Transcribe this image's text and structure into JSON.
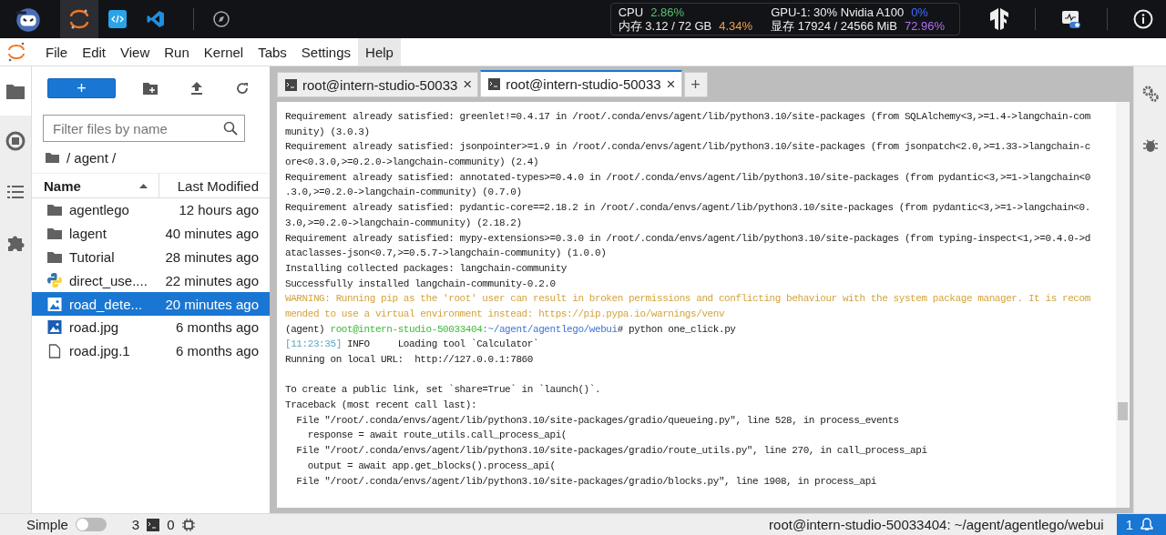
{
  "top_bar": {
    "cpu_label": "CPU",
    "cpu_value": "2.86%",
    "mem_label": "内存 3.12 / 72 GB",
    "mem_value": "4.34%",
    "gpu_label": "GPU-1: 30% Nvidia A100",
    "gpu_value": "0%",
    "vram_label": "显存 17924 / 24566 MiB",
    "vram_value": "72.96%"
  },
  "menu": [
    {
      "label": "File",
      "selected": false
    },
    {
      "label": "Edit",
      "selected": false
    },
    {
      "label": "View",
      "selected": false
    },
    {
      "label": "Run",
      "selected": false
    },
    {
      "label": "Kernel",
      "selected": false
    },
    {
      "label": "Tabs",
      "selected": false
    },
    {
      "label": "Settings",
      "selected": false
    },
    {
      "label": "Help",
      "selected": true
    }
  ],
  "file_browser": {
    "new_button": "+",
    "filter_placeholder": "Filter files by name",
    "path": "/ agent /",
    "columns": [
      "Name",
      "Last Modified"
    ],
    "files": [
      {
        "name": "agentlego",
        "modified": "12 hours ago",
        "kind": "folder",
        "selected": false
      },
      {
        "name": "lagent",
        "modified": "40 minutes ago",
        "kind": "folder",
        "selected": false
      },
      {
        "name": "Tutorial",
        "modified": "28 minutes ago",
        "kind": "folder",
        "selected": false
      },
      {
        "name": "direct_use....",
        "modified": "22 minutes ago",
        "kind": "python",
        "selected": false
      },
      {
        "name": "road_dete...",
        "modified": "20 minutes ago",
        "kind": "image",
        "selected": true
      },
      {
        "name": "road.jpg",
        "modified": "6 months ago",
        "kind": "image",
        "selected": false
      },
      {
        "name": "road.jpg.1",
        "modified": "6 months ago",
        "kind": "file",
        "selected": false
      }
    ]
  },
  "tabs": [
    {
      "label": "root@intern-studio-50033",
      "close": "×",
      "selected": false
    },
    {
      "label": "root@intern-studio-50033",
      "close": "×",
      "selected": true
    }
  ],
  "new_tab": "+",
  "terminal": [
    {
      "kind": "plain",
      "text": "Requirement already satisfied: greenlet!=0.4.17 in /root/.conda/envs/agent/lib/python3.10/site-packages (from SQLAlchemy<3,>=1.4->langchain-com"
    },
    {
      "kind": "plain",
      "text": "munity) (3.0.3)"
    },
    {
      "kind": "plain",
      "text": "Requirement already satisfied: jsonpointer>=1.9 in /root/.conda/envs/agent/lib/python3.10/site-packages (from jsonpatch<2.0,>=1.33->langchain-c"
    },
    {
      "kind": "plain",
      "text": "ore<0.3.0,>=0.2.0->langchain-community) (2.4)"
    },
    {
      "kind": "plain",
      "text": "Requirement already satisfied: annotated-types>=0.4.0 in /root/.conda/envs/agent/lib/python3.10/site-packages (from pydantic<3,>=1->langchain<0"
    },
    {
      "kind": "plain",
      "text": ".3.0,>=0.2.0->langchain-community) (0.7.0)"
    },
    {
      "kind": "plain",
      "text": "Requirement already satisfied: pydantic-core==2.18.2 in /root/.conda/envs/agent/lib/python3.10/site-packages (from pydantic<3,>=1->langchain<0."
    },
    {
      "kind": "plain",
      "text": "3.0,>=0.2.0->langchain-community) (2.18.2)"
    },
    {
      "kind": "plain",
      "text": "Requirement already satisfied: mypy-extensions>=0.3.0 in /root/.conda/envs/agent/lib/python3.10/site-packages (from typing-inspect<1,>=0.4.0->d"
    },
    {
      "kind": "plain",
      "text": "ataclasses-json<0.7,>=0.5.7->langchain-community) (1.0.0)"
    },
    {
      "kind": "plain",
      "text": "Installing collected packages: langchain-community"
    },
    {
      "kind": "plain",
      "text": "Successfully installed langchain-community-0.2.0"
    },
    {
      "kind": "warning",
      "text": "WARNING: Running pip as the 'root' user can result in broken permissions and conflicting behaviour with the system package manager. It is recom"
    },
    {
      "kind": "warning",
      "text": "mended to use a virtual environment instead: https://pip.pypa.io/warnings/venv"
    },
    {
      "kind": "prompt",
      "env": "(agent)",
      "user": "root@intern-studio-50033404",
      "path": ":~/agent/agentlego/webui",
      "text": "# python one_click.py"
    },
    {
      "kind": "info",
      "time": "[11:23:35]",
      "text": "INFO     Loading tool `Calculator`"
    },
    {
      "kind": "plain",
      "text": "Running on local URL:  http://127.0.0.1:7860"
    },
    {
      "kind": "blank"
    },
    {
      "kind": "plain",
      "text": "To create a public link, set `share=True` in `launch()`."
    },
    {
      "kind": "plain",
      "text": "Traceback (most recent call last):"
    },
    {
      "kind": "plain",
      "text": "  File \"/root/.conda/envs/agent/lib/python3.10/site-packages/gradio/queueing.py\", line 528, in process_events"
    },
    {
      "kind": "plain",
      "text": "    response = await route_utils.call_process_api("
    },
    {
      "kind": "plain",
      "text": "  File \"/root/.conda/envs/agent/lib/python3.10/site-packages/gradio/route_utils.py\", line 270, in call_process_api"
    },
    {
      "kind": "plain",
      "text": "    output = await app.get_blocks().process_api("
    },
    {
      "kind": "plain",
      "text": "  File \"/root/.conda/envs/agent/lib/python3.10/site-packages/gradio/blocks.py\", line 1908, in process_api"
    }
  ],
  "status_bar": {
    "mode": "Simple",
    "simple_on": false,
    "terminals": "3",
    "kernels": "0",
    "path": "root@intern-studio-50033404: ~/agent/agentlego/webui",
    "notifications": "1"
  }
}
